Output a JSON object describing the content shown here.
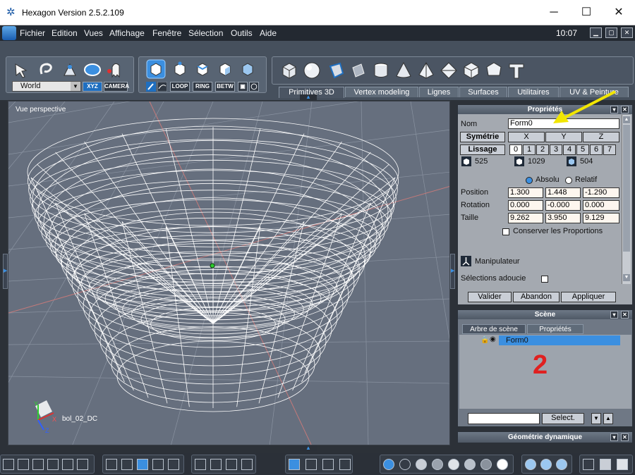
{
  "window": {
    "title": "Hexagon Version 2.5.2.109",
    "minimize": "─",
    "maximize": "☐",
    "close": "✕"
  },
  "menu": {
    "items": [
      "Fichier",
      "Edition",
      "Vues",
      "Affichage",
      "Fenêtre",
      "Sélection",
      "Outils",
      "Aide"
    ],
    "clock": "10:07"
  },
  "toolbar": {
    "coord_system": "World",
    "xyz_label": "XYZ",
    "camera_label": "CAMERA",
    "loop_label": "LOOP",
    "ring_label": "RING",
    "betw_label": "BETW",
    "tabs": [
      "Primitives 3D",
      "Vertex modeling",
      "Lignes",
      "Surfaces",
      "Utilitaires",
      "UV & Peinture"
    ],
    "active_tab": "Primitives 3D"
  },
  "viewport": {
    "label": "Vue perspective",
    "object_label": "bol_02_DC",
    "axes": [
      "Y",
      "X",
      "Z"
    ]
  },
  "properties": {
    "title": "Propriétés",
    "name_label": "Nom",
    "name_value": "Form0",
    "symmetry_label": "Symétrie",
    "axes": [
      "X",
      "Y",
      "Z"
    ],
    "smoothing_label": "Lissage",
    "smoothing_levels": [
      "0",
      "1",
      "2",
      "3",
      "4",
      "5",
      "6",
      "7"
    ],
    "counts": [
      "525",
      "1029",
      "504"
    ],
    "absolute_label": "Absolu",
    "relative_label": "Relatif",
    "position_label": "Position",
    "position": [
      "1.300",
      "1.448",
      "-1.290"
    ],
    "rotation_label": "Rotation",
    "rotation": [
      "0.000",
      "-0.000",
      "0.000"
    ],
    "size_label": "Taille",
    "size": [
      "9.262",
      "3.950",
      "9.129"
    ],
    "keep_proportions_label": "Conserver les Proportions",
    "manipulator_label": "Manipulateur",
    "soft_selection_label": "Sélections adoucie",
    "validate_label": "Valider",
    "abort_label": "Abandon",
    "apply_label": "Appliquer"
  },
  "scene": {
    "title": "Scène",
    "tab_tree": "Arbre de scène",
    "tab_props": "Propriétés",
    "item": "Form0",
    "annotation": "2",
    "select_label": "Select."
  },
  "dyn_geometry": {
    "title": "Géométrie dynamique"
  },
  "colors": {
    "accent": "#3b8fe0",
    "annotation_red": "#e02020",
    "annotation_arrow": "#f2e600",
    "field_bg": "#fdf6ef"
  }
}
